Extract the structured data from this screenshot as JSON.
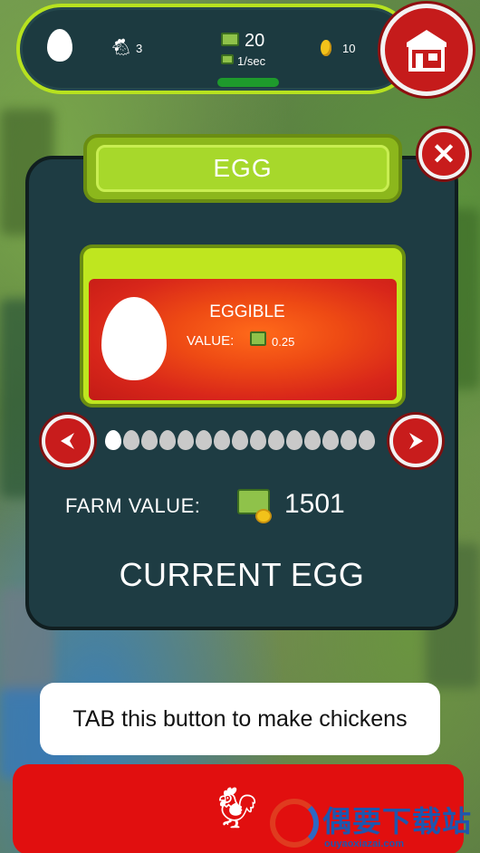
{
  "hud": {
    "chicken_count": "3",
    "cash": "20",
    "rate": "1/sec",
    "gold": "10",
    "icons": [
      "egg-icon",
      "chicken-icon",
      "cash-icon",
      "gold-egg-icon",
      "shop-icon"
    ]
  },
  "panel": {
    "title": "EGG",
    "egg_name": "EGGIBLE",
    "value_label": "VALUE:",
    "value": "0.25",
    "total_eggs": 15,
    "active_egg_index": 0,
    "farm_value_label": "FARM VALUE:",
    "farm_value": "1501",
    "status": "CURRENT EGG"
  },
  "tip": {
    "text": "TAB this button to make chickens"
  },
  "watermark": {
    "main": "偶要下载站",
    "sub": "ouyaoxiazai.com"
  },
  "colors": {
    "accent_green": "#a7d82b",
    "panel_bg": "#1e3c43",
    "button_red": "#e10f0f",
    "card_orange": "#ee4a14"
  }
}
